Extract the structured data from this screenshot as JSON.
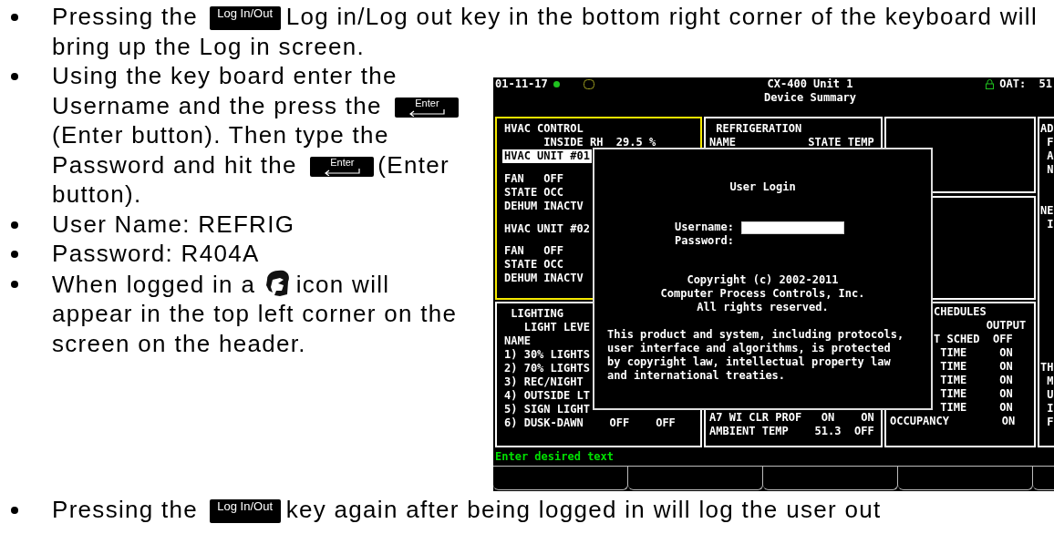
{
  "intro_bullet": {
    "segments": [
      {
        "kind": "text",
        "text": "Pressing the"
      },
      {
        "kind": "logkey",
        "text": "Log In/Out"
      },
      {
        "kind": "text",
        "text": "Log in/Log out key in the bottom right corner of the keyboard will"
      },
      {
        "kind": "text",
        "text": "bring up the Log in screen."
      }
    ]
  },
  "steps": [
    {
      "segments": [
        {
          "kind": "text",
          "text": "Using the key board enter the"
        },
        {
          "kind": "text",
          "text": "Username and the press the"
        },
        {
          "kind": "enterkey",
          "text": "Enter"
        },
        {
          "kind": "text",
          "text": "(Enter button). Then type the"
        },
        {
          "kind": "text",
          "text": "Password and hit the"
        },
        {
          "kind": "enterkey",
          "text": "Enter"
        },
        {
          "kind": "text",
          "text": "(Enter"
        },
        {
          "kind": "text",
          "text": "button)."
        }
      ]
    },
    {
      "segments": [
        {
          "kind": "text",
          "text": "User Name: REFRIG"
        }
      ]
    },
    {
      "segments": [
        {
          "kind": "text",
          "text": "Password: R404A"
        }
      ]
    },
    {
      "segments": [
        {
          "kind": "text",
          "text": "When logged in a"
        },
        {
          "kind": "usericon"
        },
        {
          "kind": "text",
          "text": "icon will"
        },
        {
          "kind": "text",
          "text": "appear in the top left corner on the"
        },
        {
          "kind": "text",
          "text": "screen on the header."
        }
      ]
    }
  ],
  "screen": {
    "header": {
      "date": "01-11-17",
      "title": "CX-400 Unit 1",
      "subtitle": "Device Summary",
      "oat": "OAT:  51"
    },
    "hvac": {
      "title": "HVAC CONTROL",
      "reading": "INSIDE RH  29.5 %",
      "units": [
        {
          "name": "HVAC UNIT #01",
          "selected": true,
          "rows": [
            "FAN   OFF",
            "STATE OCC",
            "DEHUM INACTV"
          ]
        },
        {
          "name": "HVAC UNIT #02",
          "selected": false,
          "rows": [
            "FAN   OFF",
            "STATE OCC",
            "DEHUM INACTV"
          ]
        }
      ]
    },
    "refrigeration": {
      "title": "REFRIGERATION",
      "header": "NAME           STATE TEMP"
    },
    "lighting": {
      "title": "LIGHTING",
      "subtitle": "LIGHT LEVE",
      "header": "NAME",
      "rows": [
        "1) 30% LIGHTS",
        "2) 70% LIGHTS",
        "3) REC/NIGHT",
        "4) OUTSIDE LT",
        "5) SIGN LIGHT",
        "6) DUSK-DAWN    OFF    OFF"
      ]
    },
    "circuits": {
      "rows": [
        "A7 WI CLR PROF   ON    ON",
        "AMBIENT TEMP    51.3  OFF"
      ]
    },
    "schedules": {
      "title": "CHEDULES",
      "header": "OUTPUT",
      "rows": [
        "T SCHED  OFF",
        "TIME     ON",
        "TIME     ON",
        "TIME     ON",
        "TIME     ON",
        "TIME     ON"
      ],
      "footer": "OCCUPANCY        ON"
    },
    "side": {
      "groups": [
        [
          "AD",
          "F",
          "A",
          "N"
        ],
        [
          "NE",
          "I"
        ],
        [
          "TH",
          "M",
          "U",
          "I",
          "F"
        ]
      ]
    },
    "status": "Enter desired text",
    "login": {
      "title": "User Login",
      "username_label": "Username:",
      "password_label": "Password:",
      "copyright": [
        "Copyright (c) 2002-2011",
        "Computer Process Controls, Inc.",
        "All rights reserved."
      ],
      "notice": [
        "This product and system, including protocols,",
        "user interface and algorithms, is protected",
        "by copyright law, intellectual property law",
        "and international treaties."
      ]
    }
  },
  "outro_bullet": {
    "segments": [
      {
        "kind": "text",
        "text": "Pressing the"
      },
      {
        "kind": "logkey",
        "text": "Log In/Out"
      },
      {
        "kind": "text",
        "text": "key again after being logged in will log the user out"
      }
    ]
  }
}
